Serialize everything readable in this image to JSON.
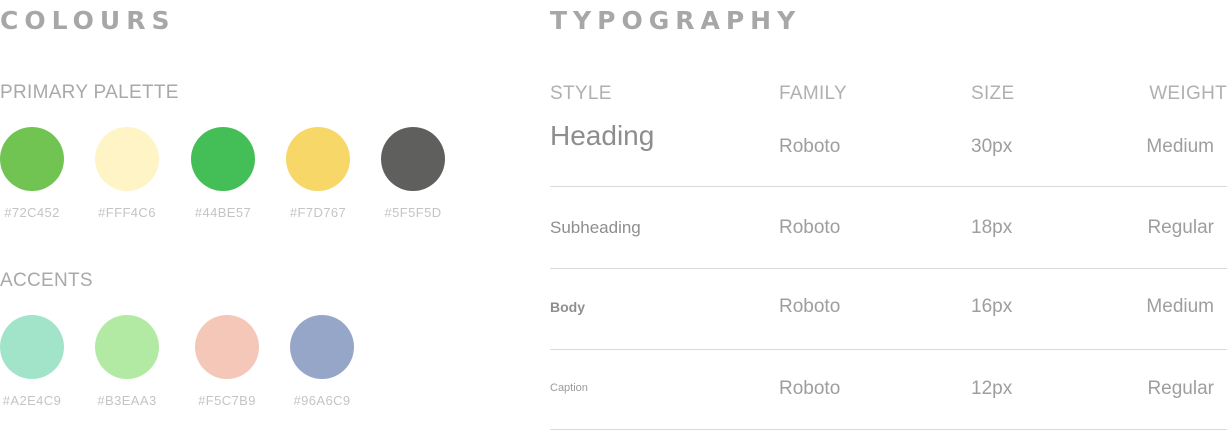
{
  "colours": {
    "title": "COLOURS",
    "primary_label": "PRIMARY PALETTE",
    "accents_label": "ACCENTS",
    "primary": [
      {
        "hex": "#72C452",
        "color": "#72C452"
      },
      {
        "hex": "#FFF4C6",
        "color": "#FFF4C6"
      },
      {
        "hex": "#44BE57",
        "color": "#44BE57"
      },
      {
        "hex": "#F7D767",
        "color": "#F7D767"
      },
      {
        "hex": "#5F5F5D",
        "color": "#5F5F5D"
      }
    ],
    "accents": [
      {
        "hex": "#A2E4C9",
        "color": "#A2E4C9"
      },
      {
        "hex": "#B3EAA3",
        "color": "#B3EAA3"
      },
      {
        "hex": "#F5C7B9",
        "color": "#F5C7B9"
      },
      {
        "hex": "#96A6C9",
        "color": "#96A6C9"
      }
    ]
  },
  "typography": {
    "title": "TYPOGRAPHY",
    "headers": {
      "style": "STYLE",
      "family": "FAMILY",
      "size": "SIZE",
      "weight": "WEIGHT"
    },
    "rows": [
      {
        "style": "Heading",
        "family": "Roboto",
        "size": "30px",
        "weight": "Medium"
      },
      {
        "style": "Subheading",
        "family": "Roboto",
        "size": "18px",
        "weight": "Regular"
      },
      {
        "style": "Body",
        "family": "Roboto",
        "size": "16px",
        "weight": "Medium"
      },
      {
        "style": "Caption",
        "family": "Roboto",
        "size": "12px",
        "weight": "Regular"
      }
    ]
  }
}
